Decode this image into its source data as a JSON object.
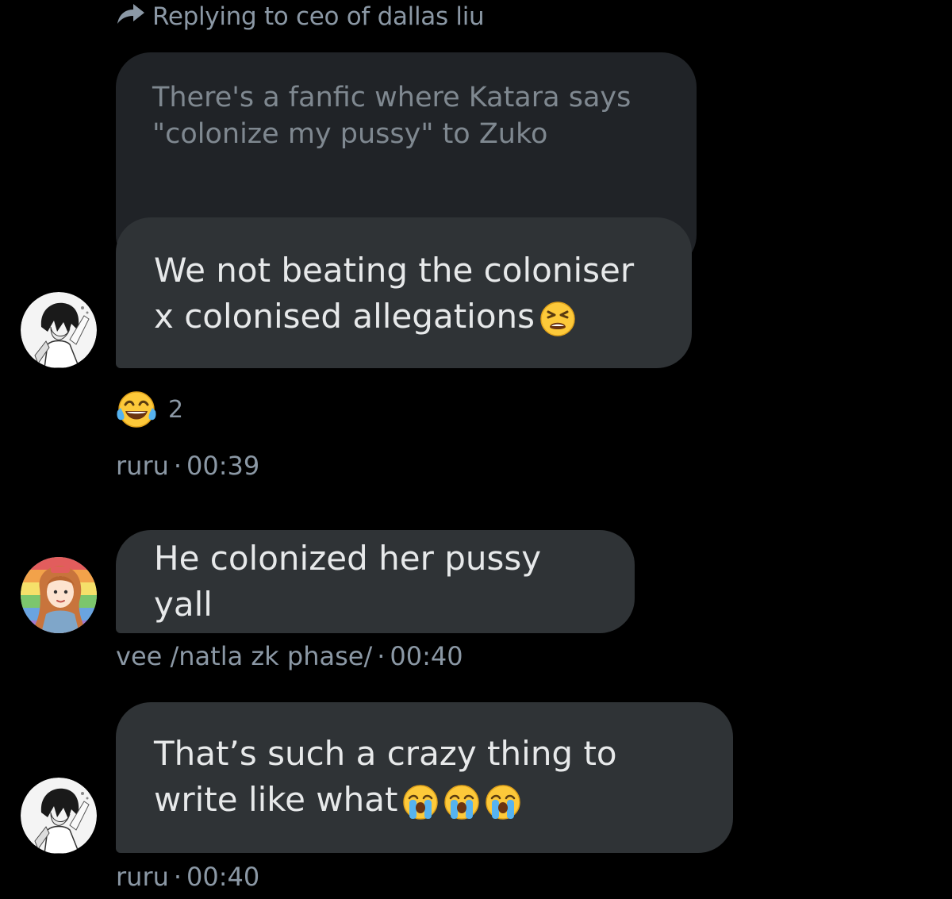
{
  "reply_header": {
    "icon": "reply-arrow-icon",
    "text": "Replying to ceo of dallas liu"
  },
  "quoted_message": {
    "text": "There's a fanfic where Katara says \"colonize my pussy\" to Zuko"
  },
  "messages": [
    {
      "avatar": "anime-boy-avatar",
      "text": "We not beating the coloniser x colonised allegations",
      "emojis": [
        "tired-face-emoji"
      ],
      "reaction": {
        "emoji": "tears-of-joy-emoji",
        "count": "2"
      },
      "author": "ruru",
      "time": "00:39"
    },
    {
      "avatar": "redhead-girl-avatar",
      "text": "He colonized her pussy yall",
      "emojis": [],
      "author": "vee /natla zk phase/",
      "time": "00:40"
    },
    {
      "avatar": "anime-boy-avatar",
      "text": "That’s such a crazy thing to write like what",
      "emojis": [
        "loudly-crying-emoji",
        "loudly-crying-emoji",
        "loudly-crying-emoji"
      ],
      "author": "ruru",
      "time": "00:40"
    }
  ],
  "separator": "·",
  "colors": {
    "background": "#000000",
    "bubble": "#2f3336",
    "quoted_bubble": "#202327",
    "text": "#e7e9ea",
    "muted": "#8b98a5"
  }
}
